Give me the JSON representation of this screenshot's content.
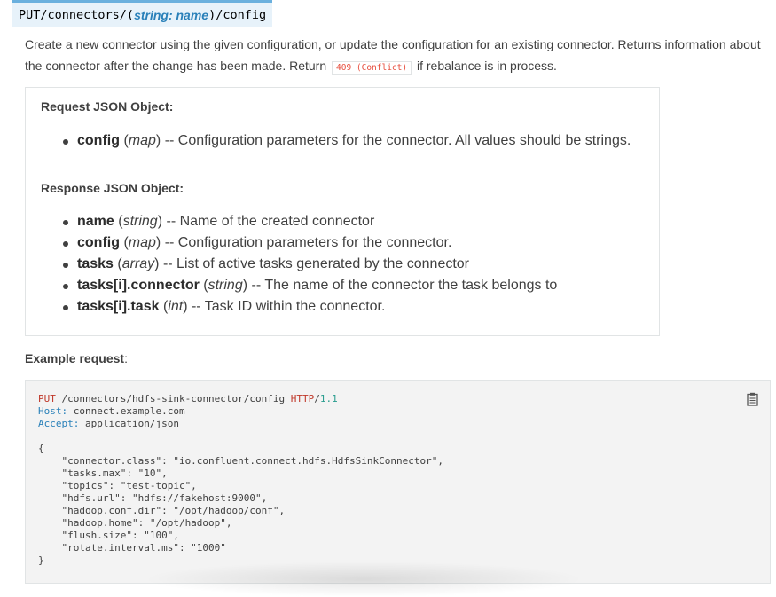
{
  "signature": {
    "method": "PUT",
    "path_prefix": "/connectors/(",
    "param": "string: name",
    "path_suffix": ")/config"
  },
  "description": {
    "part1": "Create a new connector using the given configuration, or update the configuration for an existing connector. Returns information about the connector after the change has been made. Return",
    "code": "409 (Conflict)",
    "part2": "if rebalance is in process."
  },
  "request": {
    "title": "Request JSON Object:",
    "fields": [
      {
        "name": "config",
        "type": "map",
        "desc": "-- Configuration parameters for the connector. All values should be strings."
      }
    ]
  },
  "response": {
    "title": "Response JSON Object:",
    "fields": [
      {
        "name": "name",
        "type": "string",
        "desc": "-- Name of the created connector"
      },
      {
        "name": "config",
        "type": "map",
        "desc": "-- Configuration parameters for the connector."
      },
      {
        "name": "tasks",
        "type": "array",
        "desc": "-- List of active tasks generated by the connector"
      },
      {
        "name": "tasks[i].connector",
        "type": "string",
        "desc": "-- The name of the connector the task belongs to"
      },
      {
        "name": "tasks[i].task",
        "type": "int",
        "desc": "-- Task ID within the connector."
      }
    ]
  },
  "example": {
    "label": "Example request",
    "colon": ":",
    "request_line": {
      "method": "PUT",
      "path": " /connectors/hdfs-sink-connector/config ",
      "proto": "HTTP",
      "version": "1.1"
    },
    "headers": [
      {
        "name": "Host:",
        "value": " connect.example.com"
      },
      {
        "name": "Accept:",
        "value": " application/json"
      }
    ],
    "open_brace": "{",
    "body_lines": [
      "    \"connector.class\": \"io.confluent.connect.hdfs.HdfsSinkConnector\",",
      "    \"tasks.max\": \"10\",",
      "    \"topics\": \"test-topic\",",
      "    \"hdfs.url\": \"hdfs://fakehost:9000\",",
      "    \"hadoop.conf.dir\": \"/opt/hadoop/conf\",",
      "    \"hadoop.home\": \"/opt/hadoop\",",
      "    \"flush.size\": \"100\",",
      "    \"rotate.interval.ms\": \"1000\""
    ],
    "close_brace": "}",
    "copy_icon": "clipboard-icon"
  }
}
